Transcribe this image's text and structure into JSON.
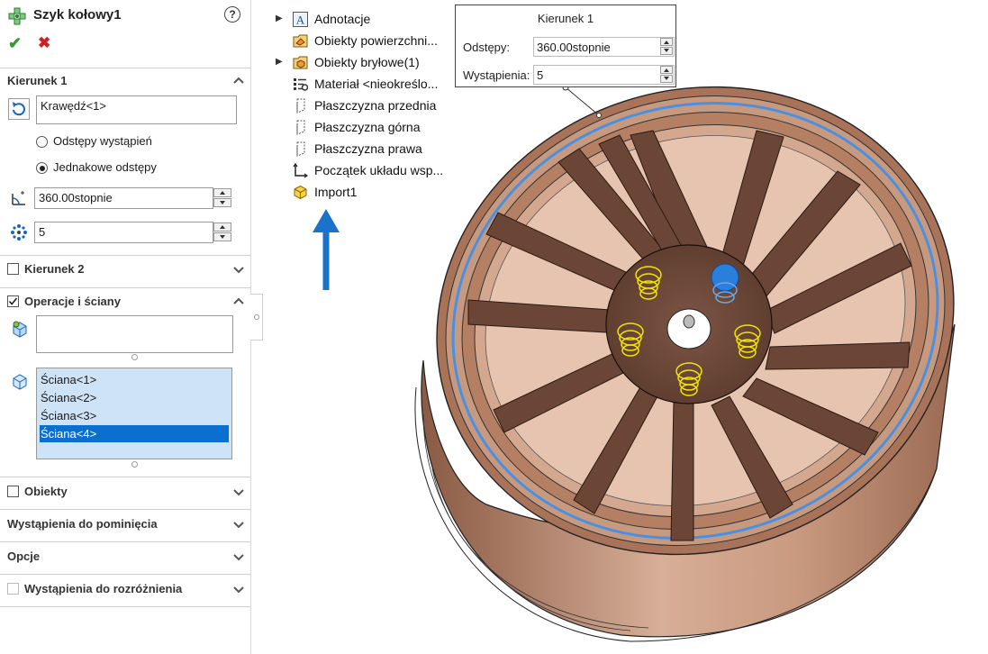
{
  "property_manager": {
    "title": "Szyk kołowy1",
    "help": "?",
    "ok_symbol": "✔",
    "cancel_symbol": "✖",
    "direction1": {
      "title": "Kierunek 1",
      "edge_value": "Krawędź<1>",
      "radio_instance_spacing": "Odstępy wystąpień",
      "radio_equal_spacing": "Jednakowe odstępy",
      "selected_radio": "Jednakowe odstępy",
      "angle_value": "360.00stopnie",
      "instances_value": "5"
    },
    "direction2": {
      "title": "Kierunek 2",
      "checked": false
    },
    "features_faces": {
      "title": "Operacje i ściany",
      "checked": true,
      "features_value": "",
      "faces": [
        "Ściana<1>",
        "Ściana<2>",
        "Ściana<3>",
        "Ściana<4>"
      ],
      "selected_face": "Ściana<4>"
    },
    "bodies": {
      "title": "Obiekty",
      "checked": false
    },
    "instances_to_skip": {
      "title": "Wystąpienia do pominięcia"
    },
    "options": {
      "title": "Opcje"
    },
    "instances_to_vary": {
      "title": "Wystąpienia do rozróżnienia",
      "checked": false,
      "enabled": false
    }
  },
  "feature_tree": {
    "items": [
      {
        "label": "Adnotacje",
        "icon": "annotations-icon",
        "expandable": true
      },
      {
        "label": "Obiekty powierzchni...",
        "icon": "surface-bodies-icon",
        "expandable": false
      },
      {
        "label": "Obiekty bryłowe(1)",
        "icon": "solid-bodies-icon",
        "expandable": true
      },
      {
        "label": "Materiał <nieokreślo...",
        "icon": "material-icon",
        "expandable": false
      },
      {
        "label": "Płaszczyzna przednia",
        "icon": "plane-icon",
        "expandable": false
      },
      {
        "label": "Płaszczyzna górna",
        "icon": "plane-icon",
        "expandable": false
      },
      {
        "label": "Płaszczyzna prawa",
        "icon": "plane-icon",
        "expandable": false
      },
      {
        "label": "Początek układu wsp...",
        "icon": "origin-icon",
        "expandable": false
      },
      {
        "label": "Import1",
        "icon": "imported-part-icon",
        "expandable": false
      }
    ]
  },
  "callout": {
    "title": "Kierunek 1",
    "spacing_label": "Odstępy:",
    "spacing_value": "360.00stopnie",
    "instances_label": "Wystąpienia:",
    "instances_value": "5"
  },
  "colors": {
    "accent_selection": "#0a6fcf",
    "list_background": "#cfe3f7",
    "ok_green": "#2f9e2f",
    "cancel_red": "#cc2222",
    "wheel_bronze": "#b88468",
    "highlight_blue": "#4a90e2",
    "highlight_yellow": "#f2e600",
    "arrow_blue": "#1a73c9"
  }
}
